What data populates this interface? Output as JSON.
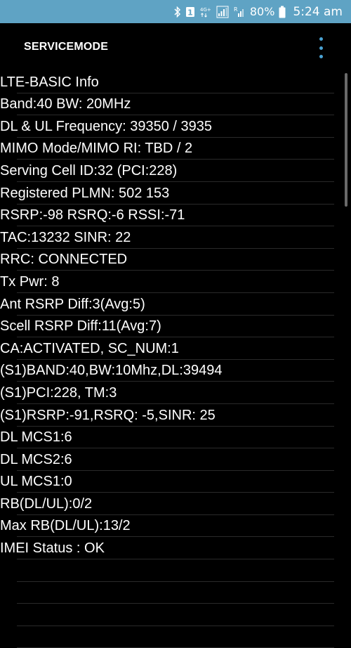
{
  "status_bar": {
    "network_type": "4G+",
    "battery": "80%",
    "time": "5:24 am",
    "notification_badge": "1",
    "icons": [
      "bluetooth-icon",
      "notification-icon",
      "network-type-icon",
      "signal-icon",
      "roaming-signal-icon",
      "battery-icon"
    ]
  },
  "toolbar": {
    "title": "SERVICEMODE",
    "menu_icon": "overflow-menu-icon"
  },
  "lines": [
    "LTE-BASIC Info",
    "Band:40 BW: 20MHz",
    "DL & UL Frequency: 39350 / 3935",
    "MIMO Mode/MIMO RI: TBD / 2",
    "Serving Cell ID:32 (PCI:228)",
    "Registered PLMN: 502 153",
    "RSRP:-98 RSRQ:-6 RSSI:-71",
    "TAC:13232 SINR: 22",
    "RRC: CONNECTED",
    "Tx Pwr: 8",
    "Ant RSRP Diff:3(Avg:5)",
    "Scell RSRP Diff:11(Avg:7)",
    "CA:ACTIVATED, SC_NUM:1",
    "(S1)BAND:40,BW:10Mhz,DL:39494",
    "(S1)PCI:228, TM:3",
    "(S1)RSRP:-91,RSRQ: -5,SINR: 25",
    "DL MCS1:6",
    "DL MCS2:6",
    "UL MCS1:0",
    "RB(DL/UL):0/2",
    "Max RB(DL/UL):13/2",
    "IMEI Status : OK",
    "",
    "",
    "",
    ""
  ]
}
